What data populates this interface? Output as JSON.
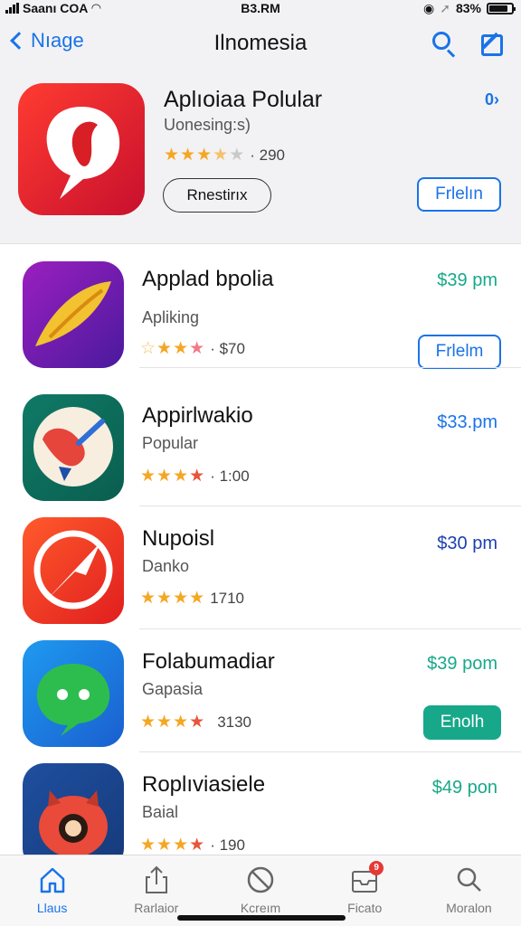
{
  "status_bar": {
    "carrier": "Saanı COA",
    "time": "B3.RM",
    "battery": "83%",
    "battery_level": 0.83
  },
  "nav": {
    "back_label": "Nıage",
    "title": "Ilnomesia"
  },
  "featured": {
    "name": "Aplıoiaa Polular",
    "subtitle": "Uonesing:s)",
    "rating_count": "· 290",
    "link_label": "0›",
    "outline_button": "Rnestirıx",
    "get_button": "Frlelın",
    "stars": 3.5
  },
  "apps": [
    {
      "name": "Applad bpolia",
      "subtitle": "Apliking",
      "rating_count": "· $70",
      "price": "$39 pm",
      "price_color": "#17a88a",
      "button": "Frlelm",
      "button_style": "outline",
      "stars": [
        "outline",
        "full",
        "full",
        "pink"
      ]
    },
    {
      "name": "Appirlwakio",
      "subtitle": "Popular",
      "rating_count": "· 1:00",
      "price": "$33.pm",
      "price_color": "#1a73e8",
      "stars": [
        "full",
        "full",
        "full",
        "red"
      ]
    },
    {
      "name": "Nupoisl",
      "subtitle": "Danko",
      "rating_count": "1710",
      "price": "$30 pm",
      "price_color": "#1e3fb0",
      "stars": [
        "full",
        "full",
        "full",
        "full"
      ]
    },
    {
      "name": "Folabumadiar",
      "subtitle": "Gapasia",
      "rating_count": "3130",
      "price": "$39 pom",
      "price_color": "#17a88a",
      "button": "Enolh",
      "button_style": "filled",
      "stars": [
        "full",
        "full",
        "full",
        "red"
      ]
    },
    {
      "name": "Roplıviasiele",
      "subtitle": "Baial",
      "rating_count": "· 190",
      "price": "$49 pon",
      "price_color": "#17a88a",
      "stars": [
        "full",
        "full",
        "full",
        "red"
      ]
    }
  ],
  "tabs": [
    {
      "label": "Llaus",
      "icon": "home-icon",
      "active": true
    },
    {
      "label": "Rarlaior",
      "icon": "share-icon",
      "active": false
    },
    {
      "label": "Kcreım",
      "icon": "no-entry-icon",
      "active": false
    },
    {
      "label": "Ficato",
      "icon": "inbox-icon",
      "active": false,
      "badge": "9"
    },
    {
      "label": "Moralon",
      "icon": "search-icon",
      "active": false
    }
  ],
  "colors": {
    "accent": "#1a73e8",
    "teal": "#17a88a",
    "star": "#f5a623",
    "filled_button": "#17a88a"
  }
}
